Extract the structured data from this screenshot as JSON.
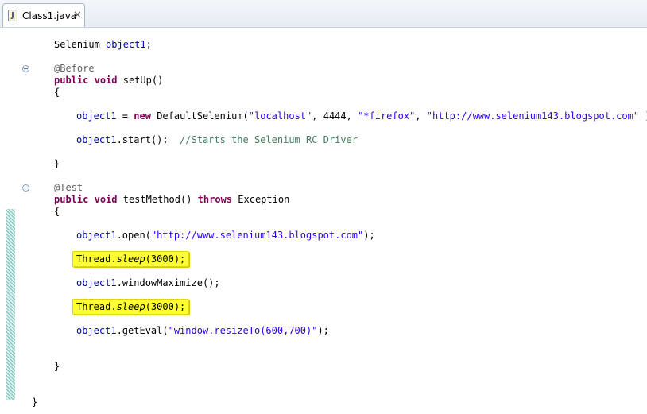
{
  "tab": {
    "title": "Class1.java",
    "file_icon": "J",
    "close_glyph": "✕"
  },
  "code": {
    "field_type": "Selenium",
    "field_name": "object1",
    "semi": ";",
    "before_annotation": "@Before",
    "kw_public": "public",
    "kw_void": "void",
    "setup_sig": "setUp()",
    "open_brace": "{",
    "close_brace": "}",
    "obj": "object1",
    "assign": " = ",
    "kw_new": "new",
    "ds_call": "DefaultSelenium(",
    "str_localhost": "\"localhost\"",
    "args_mid": ", 4444, ",
    "str_firefox": "\"*firefox\"",
    "comma": ", ",
    "str_url": "\"http://www.selenium143.blogspot.com\"",
    "ds_end": " );",
    "start_call": ".start();",
    "start_comment": "//Starts the Selenium RC Driver",
    "test_annotation": "@Test",
    "test_sig": "testMethod()",
    "kw_throws": "throws",
    "exception": "Exception",
    "open_call": ".open(",
    "open_end": ");",
    "thread_prefix": "Thread.",
    "sleep_name": "sleep",
    "sleep_args": "(3000);",
    "maximize_call": ".windowMaximize();",
    "geteval_call": ".getEval(",
    "str_resize": "\"window.resizeTo(600,700)\"",
    "geteval_end": ");"
  }
}
